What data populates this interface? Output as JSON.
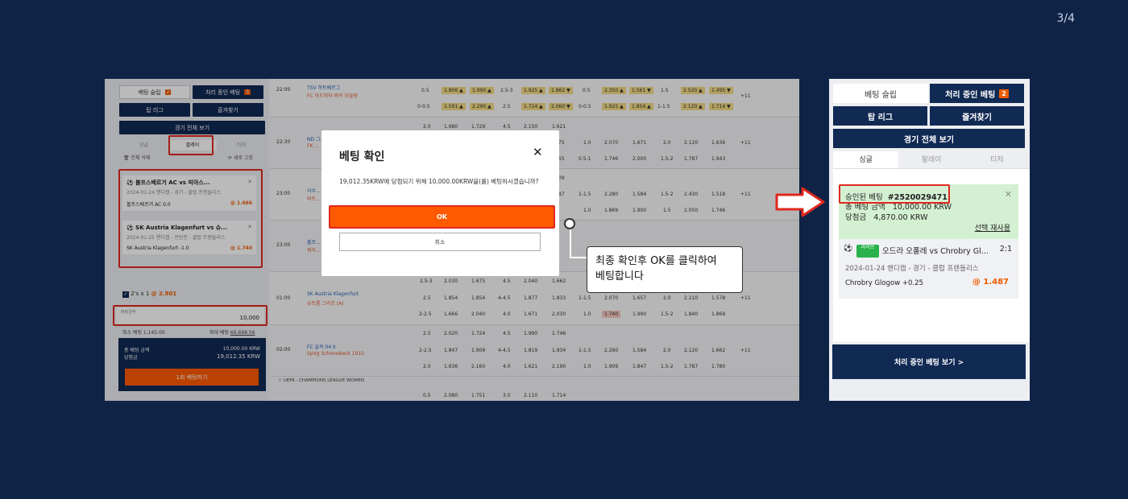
{
  "page_counter": "3/4",
  "left": {
    "sidebar": {
      "btn_betslip": "베팅 슬립",
      "btn_betslip_badge": "2",
      "btn_pending": "처리 중인 베팅",
      "btn_pending_badge": "3",
      "btn_top_league": "탑 리그",
      "btn_favorites": "즐겨찾기",
      "btn_all_matches": "경기 전체 보기",
      "tabs": [
        "싱글",
        "팔레이",
        "티저"
      ],
      "delete_all": "전체 삭제",
      "refresh": "새로 고침",
      "cards": [
        {
          "title": "볼프스베르거 AC vs 피아스...",
          "sub": "2024-01-24 핸디캡 - 경기 - 클럽 프렌들리스",
          "pick": "볼프스베르거 AC 0.0",
          "odd": "@ 1.666"
        },
        {
          "title": "SK Austria Klagenfurt vs 슈...",
          "sub": "2024-01-25 핸디캡 - 전반전 - 클럽 프렌들리스",
          "pick": "SK Austria Klagenfurt -1.0",
          "odd": "@ 1.740"
        }
      ],
      "combo": "2's x 1",
      "combo_odd": "@ 2.901",
      "bet_amount_label": "베팅금액",
      "bet_amount_value": "10,000",
      "min_bet": "최소 베팅 1,145.00",
      "max_bet_label": "최대 베팅",
      "max_bet_value": "66,698.56",
      "total_label": "총 베팅 금액",
      "total_value": "10,000.00 KRW",
      "win_label": "당첨금",
      "win_value": "19,012.35 KRW",
      "place_btn": "1회 베팅하기"
    },
    "table_rows": [
      {
        "time": "22:00",
        "team1": "TSV 하트베르그",
        "team2": "FC 아드미라 와커 모들링",
        "cols": [
          "0.5",
          "1.806 ▲",
          "1.990 ▲",
          "2.5-3",
          "1.925 ▲",
          "1.862 ▼",
          "0.5",
          "2.350 ▲",
          "1.561 ▼",
          "1.5",
          "2.520 ▲",
          "1.495 ▼"
        ],
        "cols2": [
          "0-0.5",
          "1.591 ▲",
          "2.290 ▲",
          "2.5",
          "1.724 ▲",
          "2.060 ▼",
          "0-0.5",
          "1.925 ▲",
          "1.854 ▲",
          "1-1.5",
          "2.120 ▲",
          "1.714 ▼"
        ],
        "more": "+11"
      },
      {
        "time": "22:30",
        "team1": "ND 그...",
        "team2": "FK ...",
        "cols": [
          "2.0",
          "1.980",
          "1.729",
          "4.5",
          "2.150",
          "1.621"
        ],
        "cols2": [
          "75",
          "1.0",
          "2.070",
          "1.671",
          "2.0",
          "2.120",
          "1.636",
          "+11"
        ],
        "cols3": [
          "55",
          "0.5-1",
          "1.746",
          "2.000",
          "1.5-2",
          "1.787",
          "1.943"
        ]
      },
      {
        "time": "23:00",
        "team1": "사수...",
        "team2": "비트...",
        "cols": [
          "09",
          "87",
          "1-1.5",
          "2.280",
          "1.584",
          "1.5-2",
          "2.430",
          "1.518",
          "+11"
        ],
        "cols2": [
          "1.0",
          "1.869",
          "1.900",
          "1.5",
          "2.050",
          "1.746"
        ]
      },
      {
        "time": "23:00",
        "team1": "볼프...",
        "team2": "피아...",
        "cols": [],
        "cols2": []
      },
      {
        "time": "01:00",
        "team1": "SK Austria Klagenfurt",
        "team2": "슈트룸 그라츠 (A)",
        "cols": [
          "2.5-3",
          "2.030",
          "1.675",
          "4.5",
          "2.040",
          "1.662"
        ],
        "cols2": [
          "2.5",
          "1.854",
          "1.854",
          "4-4.5",
          "1.877",
          "1.833",
          "1-1.5",
          "2.070",
          "1.657",
          "2.0",
          "2.210",
          "1.578",
          "+11"
        ],
        "cols3": [
          "2-2.5",
          "1.666",
          "2.040",
          "4.0",
          "1.671",
          "2.030",
          "1.0",
          "1.740",
          "1.990",
          "1.5-2",
          "1.840",
          "1.869"
        ]
      },
      {
        "time": "02:00",
        "team1": "FC 살커 04 II",
        "team2": "SpVg Schonebeck 1910",
        "cols": [
          "2.5",
          "2.020",
          "1.724",
          "4.5",
          "1.990",
          "1.746"
        ],
        "cols2": [
          "2-2.5",
          "1.847",
          "1.909",
          "4-4.5",
          "1.819",
          "1.934",
          "1-1.5",
          "2.260",
          "1.584",
          "2.0",
          "2.120",
          "1.662",
          "+11"
        ],
        "cols3": [
          "2.0",
          "1.636",
          "2.160",
          "4.0",
          "1.621",
          "2.190",
          "1.0",
          "1.909",
          "1.847",
          "1.5-2",
          "1.787",
          "1.780"
        ]
      }
    ],
    "league_label": "UEFA - CHAMPIONS LEAGUE WOMEN",
    "last_row": [
      "0.5",
      "2.080",
      "1.751",
      "3.0",
      "2.110",
      "1.714"
    ],
    "modal": {
      "title": "베팅 확인",
      "message": "19,012.35KRW에 당첨되기 위해 10,000.00KRW을(를) 베팅하시겠습니까?",
      "ok": "OK",
      "cancel": "취소"
    }
  },
  "callout": {
    "line1": "최종 확인후 OK를 클릭하여",
    "line2": "베팅합니다"
  },
  "right": {
    "btn_betslip": "베팅 슬립",
    "btn_pending": "처리 중인 베팅",
    "btn_pending_badge": "2",
    "btn_top_league": "탑 리그",
    "btn_favorites": "즐겨찾기",
    "btn_all_matches": "경기 전체 보기",
    "tabs": [
      "싱글",
      "팔레이",
      "티저"
    ],
    "approved_label": "승인된 베팅",
    "approved_id": "#2520029471",
    "total_label": "총 베팅 금액",
    "total_value": "10,000.00 KRW",
    "win_label": "당첨금",
    "win_value": "4,870.00 KRW",
    "reuse": "선택 재사용",
    "live_badge": "라이브",
    "match": "오드라 오폴레 vs Chrobry Gl...",
    "score": "2:1",
    "sub": "2024-01-24 핸디캡 - 경기 - 클럽 프렌들리스",
    "pick": "Chrobry Glogow +0.25",
    "odd": "@ 1.487",
    "view_pending": "처리 중인 베팅 보기 >"
  },
  "colors": {
    "background": "#0f2347",
    "accent": "#ff5a00",
    "highlight": "#e0281e",
    "navy": "#112a54"
  }
}
